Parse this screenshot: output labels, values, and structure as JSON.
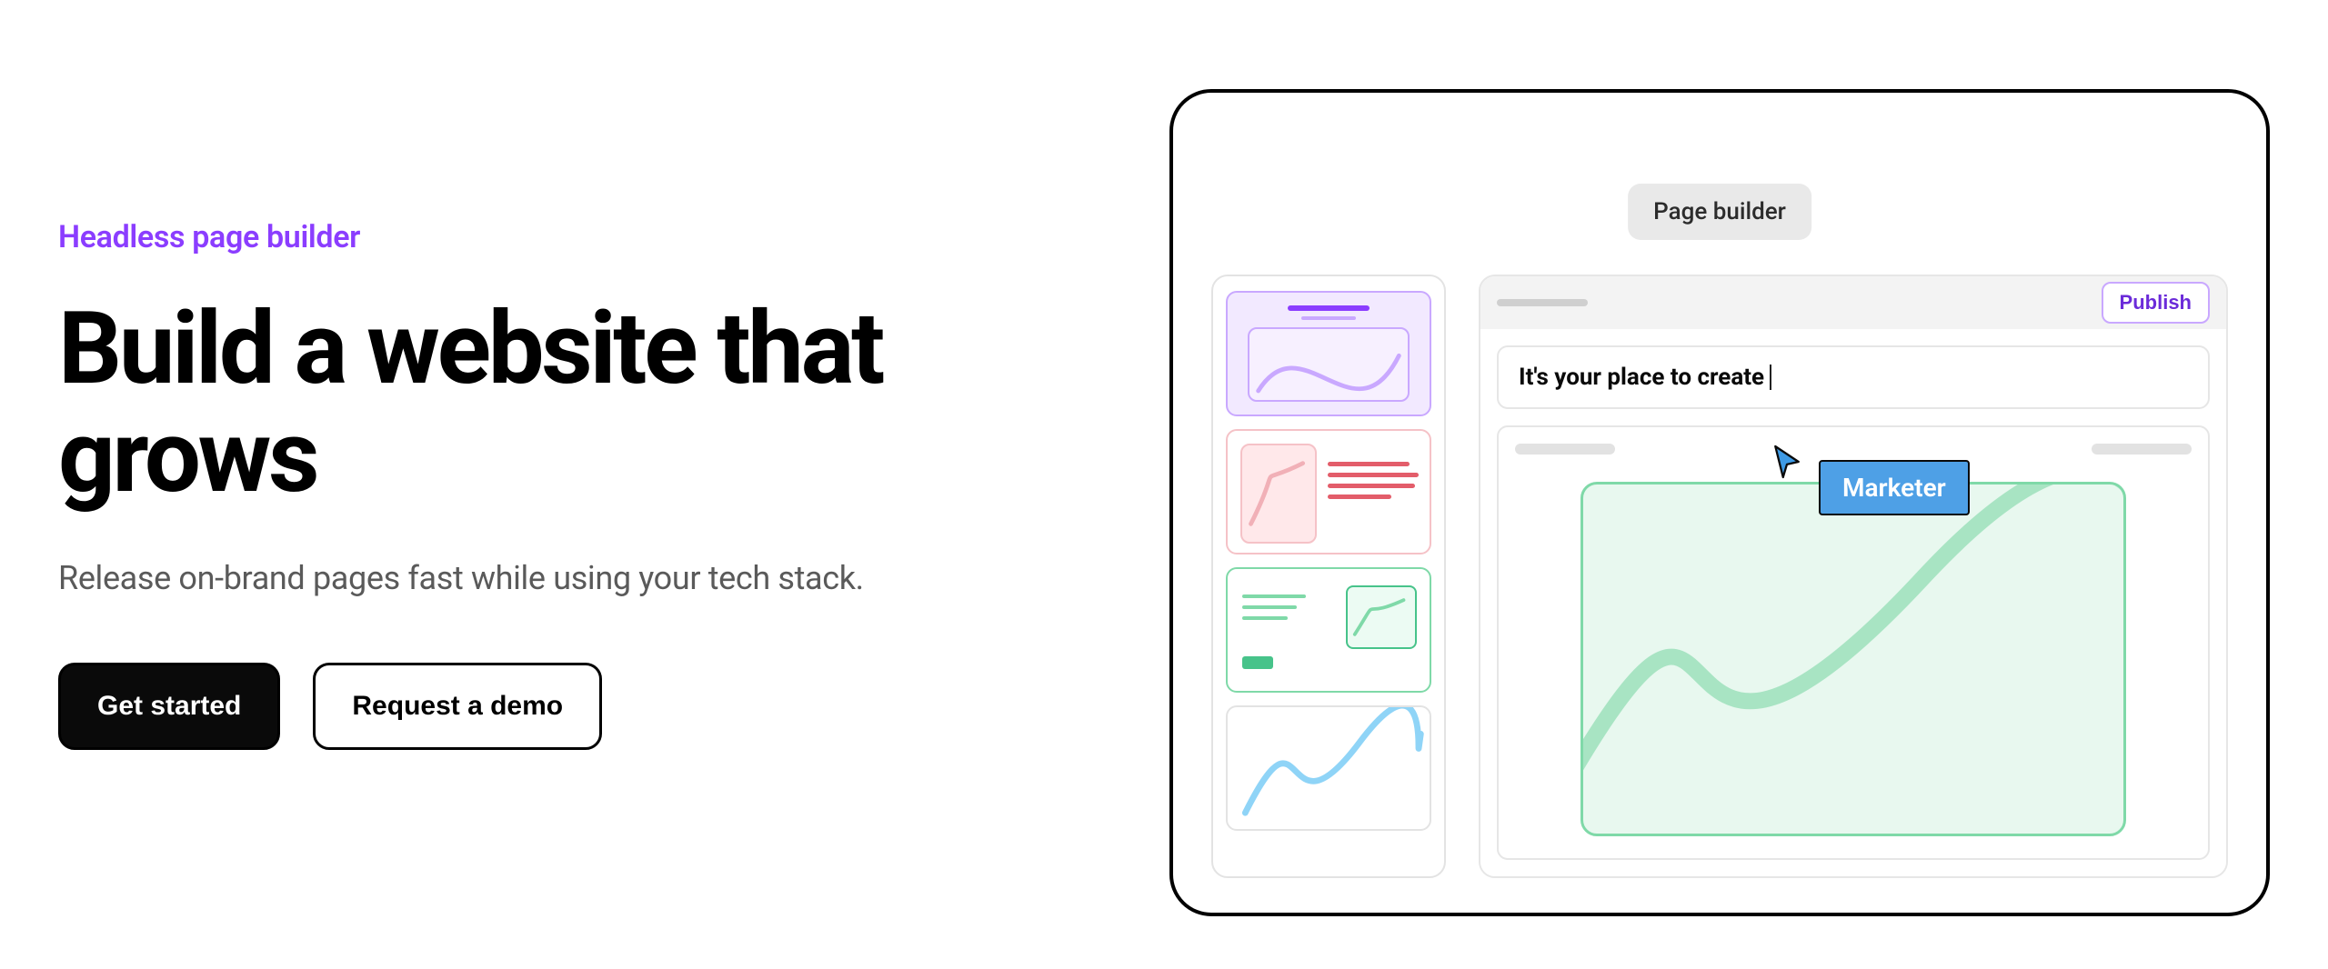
{
  "hero": {
    "eyebrow": "Headless page builder",
    "heading": "Build a website that grows",
    "subtext": "Release on-brand pages fast while using your tech stack.",
    "cta_primary": "Get started",
    "cta_secondary": "Request a demo"
  },
  "builder": {
    "tag": "Page builder",
    "publish_label": "Publish",
    "text_input": "It's your place to create",
    "cursor_role": "Marketer"
  }
}
